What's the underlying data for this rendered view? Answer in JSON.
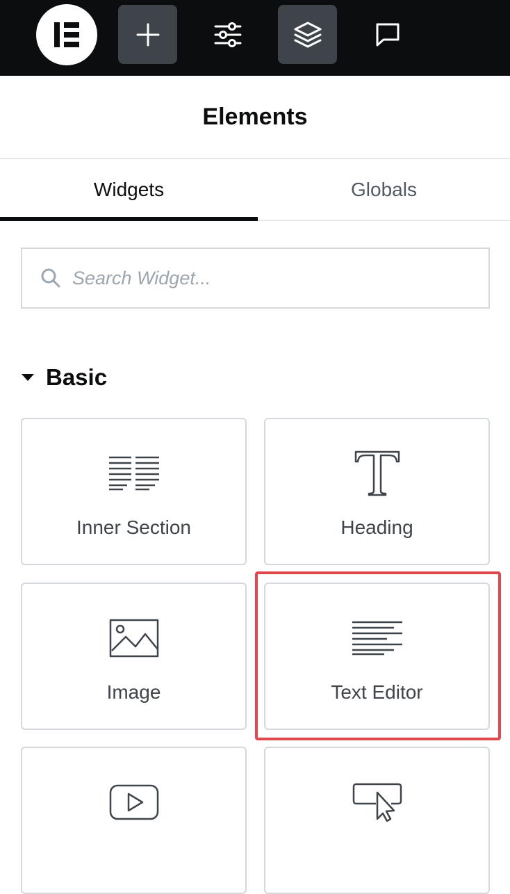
{
  "topbar": {
    "logo": "elementor-logo",
    "buttons": [
      {
        "name": "add-element-button",
        "icon": "plus-icon",
        "active": true
      },
      {
        "name": "site-settings-button",
        "icon": "sliders-icon",
        "active": false
      },
      {
        "name": "structure-button",
        "icon": "layers-icon",
        "active": true
      },
      {
        "name": "notes-button",
        "icon": "chat-bubble-icon",
        "active": false
      }
    ]
  },
  "panel": {
    "title": "Elements",
    "tabs": [
      {
        "label": "Widgets",
        "active": true
      },
      {
        "label": "Globals",
        "active": false
      }
    ]
  },
  "search": {
    "placeholder": "Search Widget...",
    "value": ""
  },
  "category": {
    "label": "Basic",
    "expanded": true
  },
  "widgets": [
    {
      "label": "Inner Section",
      "icon": "inner-section-icon"
    },
    {
      "label": "Heading",
      "icon": "heading-icon"
    },
    {
      "label": "Image",
      "icon": "image-icon"
    },
    {
      "label": "Text Editor",
      "icon": "text-editor-icon",
      "highlighted": true
    },
    {
      "label": "",
      "icon": "video-icon"
    },
    {
      "label": "",
      "icon": "button-icon"
    }
  ],
  "colors": {
    "topbar_bg": "#0c0d0e",
    "active_button_bg": "#3f444b",
    "highlight": "#e0484d",
    "border": "#d5d8dc"
  }
}
